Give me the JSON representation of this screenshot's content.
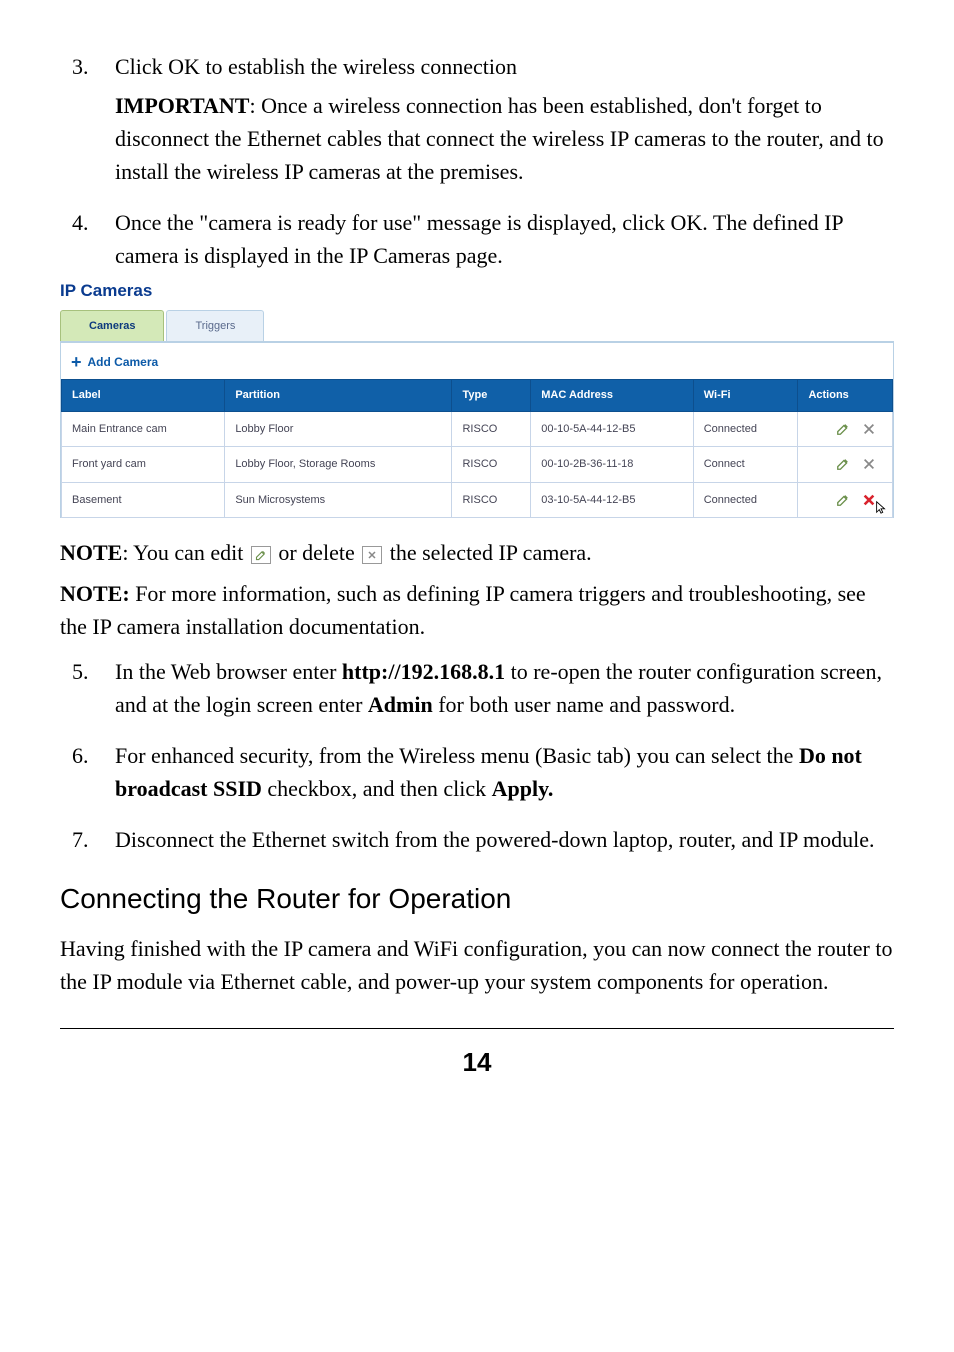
{
  "list1": {
    "item3": {
      "line1": "Click OK to establish the wireless connection",
      "important_label": "IMPORTANT",
      "important_text": ":   Once a wireless connection has been established, don't forget to disconnect the Ethernet cables that connect the wireless IP cameras to the router, and to install the wireless IP cameras at the premises."
    },
    "item4": "Once the \"camera is ready for use\" message is displayed, click OK. The defined IP camera is displayed in the IP Cameras page."
  },
  "panel": {
    "title": "IP Cameras",
    "tabs": {
      "cameras": "Cameras",
      "triggers": "Triggers"
    },
    "add_camera": "Add Camera",
    "headers": {
      "label": "Label",
      "partition": "Partition",
      "type": "Type",
      "mac": "MAC Address",
      "wifi": "Wi-Fi",
      "actions": "Actions"
    },
    "rows": [
      {
        "label": "Main Entrance cam",
        "partition": "Lobby Floor",
        "type": "RISCO",
        "mac": "00-10-5A-44-12-B5",
        "wifi": "Connected",
        "wifi_link": false,
        "delete_red": false
      },
      {
        "label": "Front yard cam",
        "partition": "Lobby Floor, Storage Rooms",
        "type": "RISCO",
        "mac": "00-10-2B-36-11-18",
        "wifi": "Connect",
        "wifi_link": true,
        "delete_red": false
      },
      {
        "label": "Basement",
        "partition": "Sun Microsystems",
        "type": "RISCO",
        "mac": "03-10-5A-44-12-B5",
        "wifi": "Connected",
        "wifi_link": false,
        "delete_red": true
      }
    ]
  },
  "notes": {
    "n1_bold": "NOTE",
    "n1_a": ": You can edit ",
    "n1_b": " or delete ",
    "n1_c": " the selected IP camera.",
    "n2_bold": "NOTE:",
    "n2_text": " For more information, such as defining IP camera triggers and troubleshooting, see the IP camera installation documentation."
  },
  "list2": {
    "item5_a": "In the Web browser enter ",
    "item5_b": "http://192.168.8.1",
    "item5_c": " to re-open the router configuration screen, and at the login screen enter ",
    "item5_d": "Admin",
    "item5_e": " for both user name and password.",
    "item6_a": "For enhanced security, from the Wireless menu (Basic tab) you can select the ",
    "item6_b": "Do not broadcast SSID",
    "item6_c": " checkbox, and then click ",
    "item6_d": "Apply.",
    "item7": "Disconnect the Ethernet switch from the powered-down laptop, router, and IP module."
  },
  "section": {
    "heading": "Connecting the Router for Operation",
    "body": "Having finished with the IP camera and WiFi configuration, you can now connect the router to the IP module via Ethernet cable, and power-up your system components for operation."
  },
  "page_number": "14"
}
